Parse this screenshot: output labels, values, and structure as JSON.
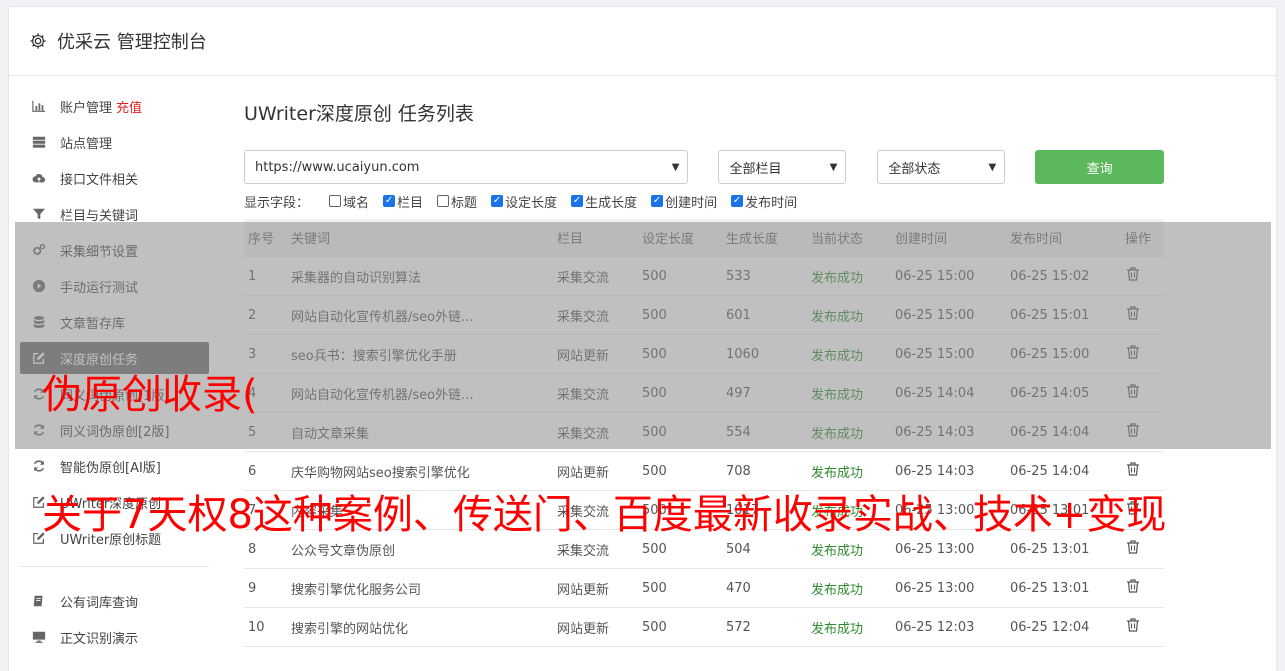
{
  "header": {
    "title": "优采云 管理控制台",
    "icon": "gear-icon"
  },
  "sidebar": {
    "items": [
      {
        "label": "账户管理",
        "badge": "充值",
        "icon": "bar-chart-icon"
      },
      {
        "label": "站点管理",
        "icon": "server-icon"
      },
      {
        "label": "接口文件相关",
        "icon": "cloud-upload-icon"
      },
      {
        "label": "栏目与关键词",
        "icon": "filter-icon"
      },
      {
        "label": "采集细节设置",
        "icon": "cogs-icon"
      },
      {
        "label": "手动运行测试",
        "icon": "play-circle-icon"
      },
      {
        "label": "文章暂存库",
        "icon": "database-icon"
      },
      {
        "label": "深度原创任务",
        "icon": "edit-icon"
      },
      {
        "label": "同义词伪原创[1版]",
        "icon": "refresh-icon"
      },
      {
        "label": "同义词伪原创[2版]",
        "icon": "refresh-icon"
      },
      {
        "label": "智能伪原创[AI版]",
        "icon": "refresh-icon"
      },
      {
        "label": "UWriter深度原创",
        "icon": "edit-icon"
      },
      {
        "label": "UWriter原创标题",
        "icon": "edit-icon"
      }
    ],
    "items2": [
      {
        "label": "公有词库查询",
        "icon": "book-icon"
      },
      {
        "label": "正文识别演示",
        "icon": "monitor-icon"
      }
    ]
  },
  "main": {
    "title": "UWriter深度原创 任务列表",
    "site_select": "https://www.ucaiyun.com",
    "column_select": "全部栏目",
    "status_select": "全部状态",
    "query_label": "查询",
    "fields_label": "显示字段：",
    "fields": [
      {
        "label": "域名",
        "checked": false
      },
      {
        "label": "栏目",
        "checked": true
      },
      {
        "label": "标题",
        "checked": false
      },
      {
        "label": "设定长度",
        "checked": true
      },
      {
        "label": "生成长度",
        "checked": true
      },
      {
        "label": "创建时间",
        "checked": true
      },
      {
        "label": "发布时间",
        "checked": true
      }
    ],
    "columns": [
      "序号",
      "关键词",
      "栏目",
      "设定长度",
      "生成长度",
      "当前状态",
      "创建时间",
      "发布时间",
      "操作"
    ],
    "rows": [
      [
        "1",
        "采集器的自动识别算法",
        "采集交流",
        "500",
        "533",
        "发布成功",
        "06-25 15:00",
        "06-25 15:02"
      ],
      [
        "2",
        "网站自动化宣传机器/seo外链...",
        "采集交流",
        "500",
        "601",
        "发布成功",
        "06-25 15:00",
        "06-25 15:01"
      ],
      [
        "3",
        "seo兵书：搜索引擎优化手册",
        "网站更新",
        "500",
        "1060",
        "发布成功",
        "06-25 15:00",
        "06-25 15:00"
      ],
      [
        "4",
        "网站自动化宣传机器/seo外链...",
        "采集交流",
        "500",
        "497",
        "发布成功",
        "06-25 14:04",
        "06-25 14:05"
      ],
      [
        "5",
        "自动文章采集",
        "采集交流",
        "500",
        "554",
        "发布成功",
        "06-25 14:03",
        "06-25 14:04"
      ],
      [
        "6",
        "庆华购物网站seo搜索引擎优化",
        "网站更新",
        "500",
        "708",
        "发布成功",
        "06-25 14:03",
        "06-25 14:04"
      ],
      [
        "7",
        "内容采集",
        "采集交流",
        "500",
        "1017",
        "发布成功",
        "06-25 13:00",
        "06-25 13:01"
      ],
      [
        "8",
        "公众号文章伪原创",
        "采集交流",
        "500",
        "504",
        "发布成功",
        "06-25 13:00",
        "06-25 13:01"
      ],
      [
        "9",
        "搜索引擎优化服务公司",
        "网站更新",
        "500",
        "470",
        "发布成功",
        "06-25 13:00",
        "06-25 13:01"
      ],
      [
        "10",
        "搜索引擎的网站优化",
        "网站更新",
        "500",
        "572",
        "发布成功",
        "06-25 12:03",
        "06-25 12:04"
      ]
    ]
  },
  "watermark": {
    "line1": "伪原创收录(",
    "line2": "关于7天权8这种案例、传送门、百度最新收录实战、技术+变现"
  },
  "colors": {
    "accent_green": "#5cb85c",
    "recharge_red": "#e02020",
    "watermark_red": "#ff0000",
    "status_green": "#2e8b2e"
  }
}
